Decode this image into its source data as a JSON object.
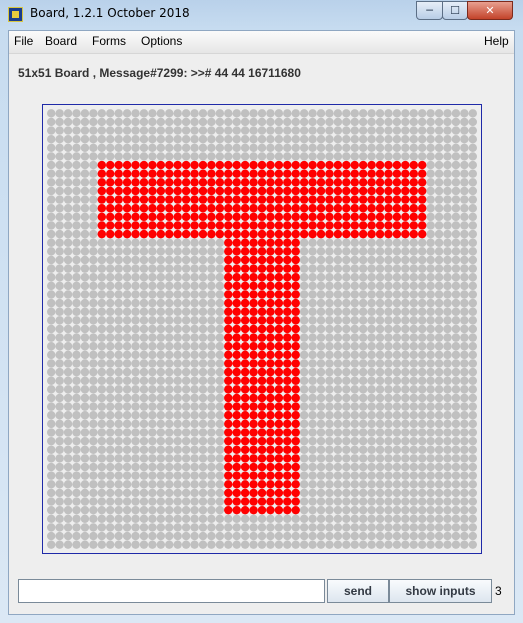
{
  "window": {
    "title": "Board, 1.2.1 October 2018",
    "controls": [
      "─",
      "☐",
      "✕"
    ]
  },
  "menu": {
    "items": [
      "File",
      "Board",
      "Forms",
      "Options"
    ],
    "help": "Help"
  },
  "status": {
    "message": "51x51 Board , Message#7299: >># 44 44 16711680"
  },
  "board": {
    "cols": 51,
    "rows": 51,
    "default_color": "#c0c0c0",
    "active_color": "#ff0000",
    "filled_regions": [
      {
        "cols": [
          6,
          44
        ],
        "rows": [
          6,
          14
        ]
      },
      {
        "cols": [
          21,
          29
        ],
        "rows": [
          15,
          46
        ]
      }
    ]
  },
  "input": {
    "value": "",
    "placeholder": ""
  },
  "buttons": {
    "send": "send",
    "show_inputs": "show inputs"
  },
  "counter": "3"
}
